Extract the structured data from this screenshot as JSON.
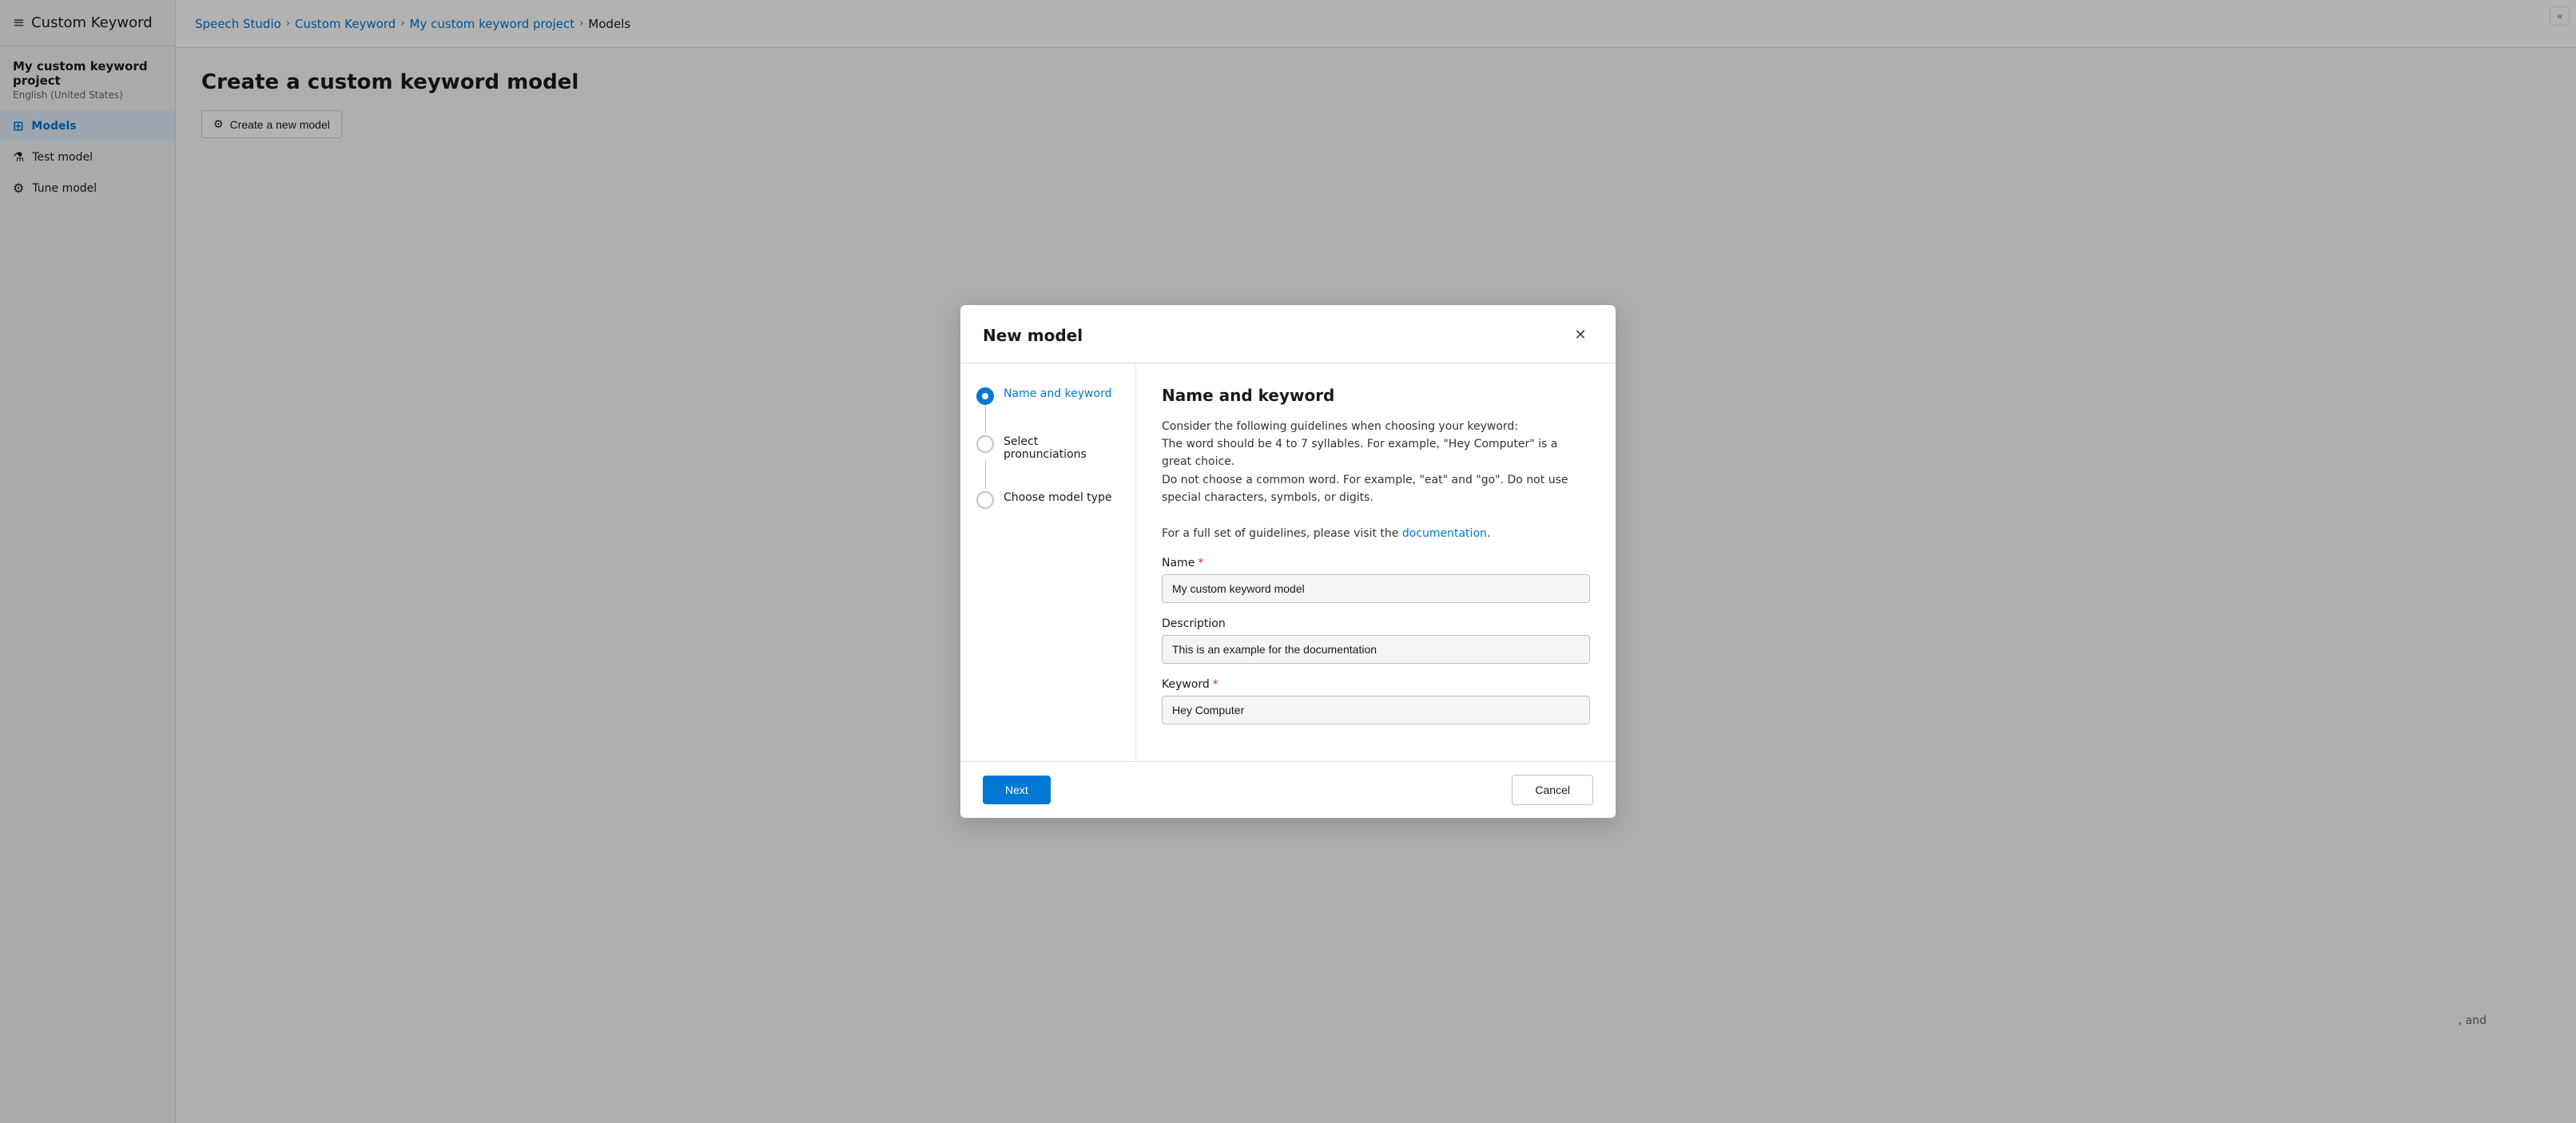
{
  "app": {
    "title": "Custom Keyword",
    "hamburger": "≡",
    "collapse_icon": "«"
  },
  "sidebar": {
    "project_name": "My custom keyword project",
    "project_lang": "English (United States)",
    "nav_items": [
      {
        "id": "models",
        "label": "Models",
        "icon": "⊞",
        "active": true
      },
      {
        "id": "test-model",
        "label": "Test model",
        "icon": "⚗"
      },
      {
        "id": "tune-model",
        "label": "Tune model",
        "icon": "⚙"
      }
    ]
  },
  "topbar": {
    "breadcrumbs": [
      {
        "id": "speech-studio",
        "label": "Speech Studio",
        "active": false
      },
      {
        "id": "custom-keyword",
        "label": "Custom Keyword",
        "active": false
      },
      {
        "id": "my-project",
        "label": "My custom keyword project",
        "active": false
      },
      {
        "id": "models",
        "label": "Models",
        "active": true
      }
    ],
    "sep": "›"
  },
  "main": {
    "page_title": "Create a custom keyword model",
    "action_btn": "Create a new model",
    "bg_text": ", and"
  },
  "dialog": {
    "title": "New model",
    "close_icon": "✕",
    "steps": [
      {
        "id": "name-keyword",
        "label": "Name and keyword",
        "active": true
      },
      {
        "id": "select-pronunciations",
        "label": "Select pronunciations",
        "active": false
      },
      {
        "id": "choose-model-type",
        "label": "Choose model type",
        "active": false
      }
    ],
    "content": {
      "title": "Name and keyword",
      "guidelines": {
        "line1": "Consider the following guidelines when choosing your keyword:",
        "line2": "The word should be 4 to 7 syllables. For example, \"Hey Computer\" is a great choice.",
        "line3": "Do not choose a common word. For example, \"eat\" and \"go\". Do not use special characters, symbols, or digits.",
        "line4_prefix": "For a full set of guidelines, please visit the ",
        "link_text": "documentation",
        "link4_suffix": "."
      },
      "fields": {
        "name_label": "Name",
        "name_required": "*",
        "name_value": "My custom keyword model",
        "description_label": "Description",
        "description_value": "This is an example for the documentation",
        "keyword_label": "Keyword",
        "keyword_required": "*",
        "keyword_value": "Hey Computer"
      }
    },
    "footer": {
      "next_label": "Next",
      "cancel_label": "Cancel"
    }
  }
}
